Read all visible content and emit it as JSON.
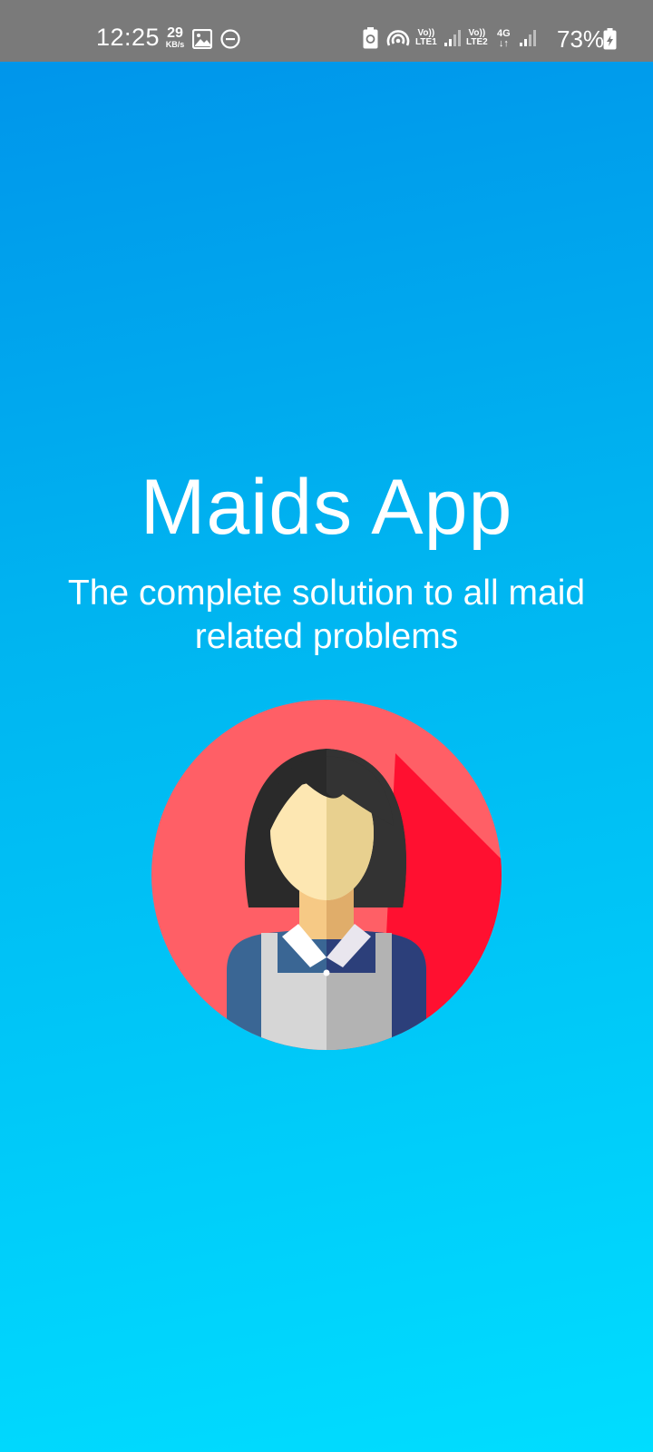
{
  "status_bar": {
    "time": "12:25",
    "speed_value": "29",
    "speed_unit": "KB/s",
    "sim1_label": "LTE1",
    "sim1_volte": "Vo))",
    "sim2_label": "LTE2",
    "sim2_volte": "Vo))",
    "network_type": "4G",
    "battery": "73%",
    "icons": [
      "image-icon",
      "do-not-disturb-icon",
      "battery-saver-icon",
      "hotspot-icon",
      "signal-icon",
      "signal-icon",
      "battery-icon"
    ]
  },
  "splash": {
    "title": "Maids App",
    "subtitle": "The complete solution to all maid related problems",
    "illustration": "maid-avatar"
  },
  "colors": {
    "background_top": "#0092ea",
    "background_bottom": "#00ddff",
    "avatar_circle": "#ff5f66",
    "avatar_shadow": "#ff1030",
    "text": "#ffffff"
  }
}
